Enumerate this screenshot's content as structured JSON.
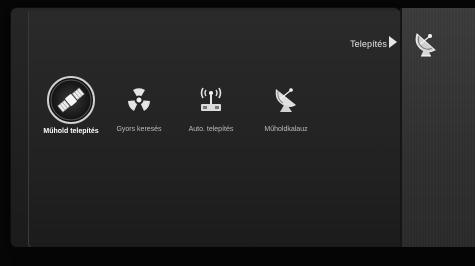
{
  "header": {
    "title": "Telepítés",
    "icon": "satellite-dish-icon"
  },
  "menu": {
    "items": [
      {
        "label": "Műhold telepítés",
        "icon": "satellite-icon",
        "selected": true
      },
      {
        "label": "Gyors keresés",
        "icon": "radiation-fan-icon",
        "selected": false
      },
      {
        "label": "Auto. telepítés",
        "icon": "antenna-tower-icon",
        "selected": false
      },
      {
        "label": "Műholdkalauz",
        "icon": "dish-antenna-icon",
        "selected": false
      }
    ]
  },
  "colors": {
    "background": "#060606",
    "panel": "#232323",
    "side_panel": "#353535",
    "text": "#e6e6e6",
    "label_muted": "#bdbdbd"
  }
}
